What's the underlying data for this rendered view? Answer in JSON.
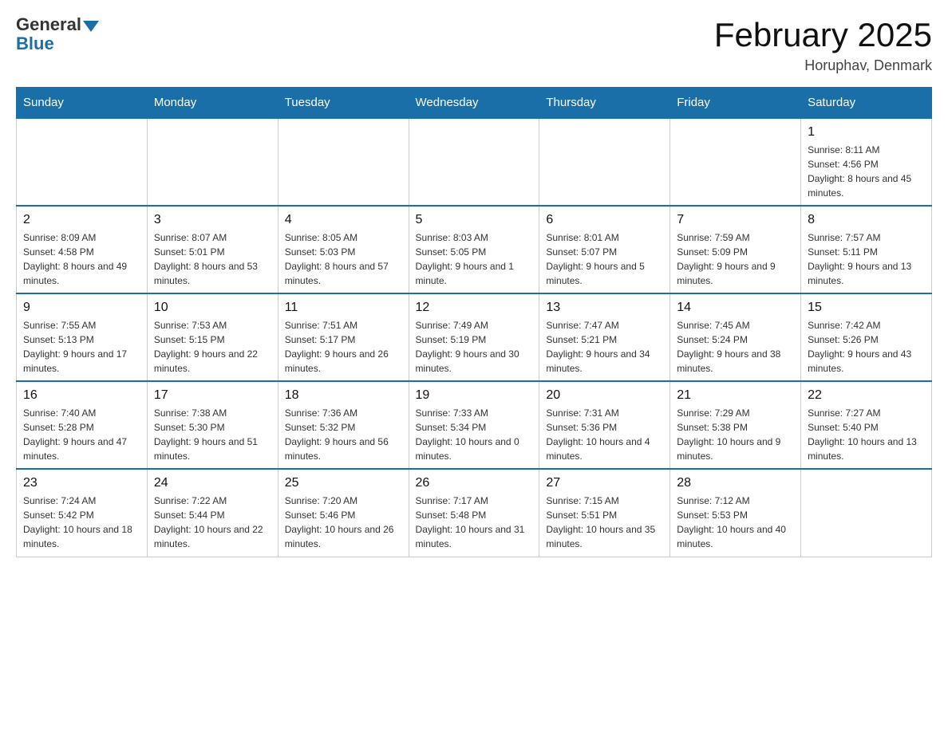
{
  "header": {
    "logo_general": "General",
    "logo_blue": "Blue",
    "month_title": "February 2025",
    "location": "Horuphav, Denmark"
  },
  "days_of_week": [
    "Sunday",
    "Monday",
    "Tuesday",
    "Wednesday",
    "Thursday",
    "Friday",
    "Saturday"
  ],
  "weeks": [
    [
      {
        "day": "",
        "info": ""
      },
      {
        "day": "",
        "info": ""
      },
      {
        "day": "",
        "info": ""
      },
      {
        "day": "",
        "info": ""
      },
      {
        "day": "",
        "info": ""
      },
      {
        "day": "",
        "info": ""
      },
      {
        "day": "1",
        "info": "Sunrise: 8:11 AM\nSunset: 4:56 PM\nDaylight: 8 hours and 45 minutes."
      }
    ],
    [
      {
        "day": "2",
        "info": "Sunrise: 8:09 AM\nSunset: 4:58 PM\nDaylight: 8 hours and 49 minutes."
      },
      {
        "day": "3",
        "info": "Sunrise: 8:07 AM\nSunset: 5:01 PM\nDaylight: 8 hours and 53 minutes."
      },
      {
        "day": "4",
        "info": "Sunrise: 8:05 AM\nSunset: 5:03 PM\nDaylight: 8 hours and 57 minutes."
      },
      {
        "day": "5",
        "info": "Sunrise: 8:03 AM\nSunset: 5:05 PM\nDaylight: 9 hours and 1 minute."
      },
      {
        "day": "6",
        "info": "Sunrise: 8:01 AM\nSunset: 5:07 PM\nDaylight: 9 hours and 5 minutes."
      },
      {
        "day": "7",
        "info": "Sunrise: 7:59 AM\nSunset: 5:09 PM\nDaylight: 9 hours and 9 minutes."
      },
      {
        "day": "8",
        "info": "Sunrise: 7:57 AM\nSunset: 5:11 PM\nDaylight: 9 hours and 13 minutes."
      }
    ],
    [
      {
        "day": "9",
        "info": "Sunrise: 7:55 AM\nSunset: 5:13 PM\nDaylight: 9 hours and 17 minutes."
      },
      {
        "day": "10",
        "info": "Sunrise: 7:53 AM\nSunset: 5:15 PM\nDaylight: 9 hours and 22 minutes."
      },
      {
        "day": "11",
        "info": "Sunrise: 7:51 AM\nSunset: 5:17 PM\nDaylight: 9 hours and 26 minutes."
      },
      {
        "day": "12",
        "info": "Sunrise: 7:49 AM\nSunset: 5:19 PM\nDaylight: 9 hours and 30 minutes."
      },
      {
        "day": "13",
        "info": "Sunrise: 7:47 AM\nSunset: 5:21 PM\nDaylight: 9 hours and 34 minutes."
      },
      {
        "day": "14",
        "info": "Sunrise: 7:45 AM\nSunset: 5:24 PM\nDaylight: 9 hours and 38 minutes."
      },
      {
        "day": "15",
        "info": "Sunrise: 7:42 AM\nSunset: 5:26 PM\nDaylight: 9 hours and 43 minutes."
      }
    ],
    [
      {
        "day": "16",
        "info": "Sunrise: 7:40 AM\nSunset: 5:28 PM\nDaylight: 9 hours and 47 minutes."
      },
      {
        "day": "17",
        "info": "Sunrise: 7:38 AM\nSunset: 5:30 PM\nDaylight: 9 hours and 51 minutes."
      },
      {
        "day": "18",
        "info": "Sunrise: 7:36 AM\nSunset: 5:32 PM\nDaylight: 9 hours and 56 minutes."
      },
      {
        "day": "19",
        "info": "Sunrise: 7:33 AM\nSunset: 5:34 PM\nDaylight: 10 hours and 0 minutes."
      },
      {
        "day": "20",
        "info": "Sunrise: 7:31 AM\nSunset: 5:36 PM\nDaylight: 10 hours and 4 minutes."
      },
      {
        "day": "21",
        "info": "Sunrise: 7:29 AM\nSunset: 5:38 PM\nDaylight: 10 hours and 9 minutes."
      },
      {
        "day": "22",
        "info": "Sunrise: 7:27 AM\nSunset: 5:40 PM\nDaylight: 10 hours and 13 minutes."
      }
    ],
    [
      {
        "day": "23",
        "info": "Sunrise: 7:24 AM\nSunset: 5:42 PM\nDaylight: 10 hours and 18 minutes."
      },
      {
        "day": "24",
        "info": "Sunrise: 7:22 AM\nSunset: 5:44 PM\nDaylight: 10 hours and 22 minutes."
      },
      {
        "day": "25",
        "info": "Sunrise: 7:20 AM\nSunset: 5:46 PM\nDaylight: 10 hours and 26 minutes."
      },
      {
        "day": "26",
        "info": "Sunrise: 7:17 AM\nSunset: 5:48 PM\nDaylight: 10 hours and 31 minutes."
      },
      {
        "day": "27",
        "info": "Sunrise: 7:15 AM\nSunset: 5:51 PM\nDaylight: 10 hours and 35 minutes."
      },
      {
        "day": "28",
        "info": "Sunrise: 7:12 AM\nSunset: 5:53 PM\nDaylight: 10 hours and 40 minutes."
      },
      {
        "day": "",
        "info": ""
      }
    ]
  ]
}
